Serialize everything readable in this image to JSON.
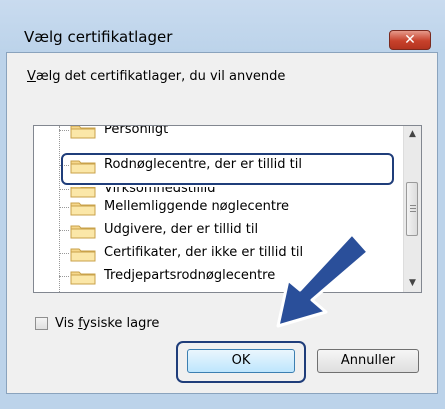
{
  "dialog": {
    "title": "Vælg certifikatlager",
    "close_label": "✕",
    "instruction_prefix": "V",
    "instruction_rest": "ælg det certifikatlager, du vil anvende"
  },
  "tree": {
    "items": [
      {
        "label": "Personligt"
      },
      {
        "label": "Rodnøglecentre, der er tillid til"
      },
      {
        "label": "Virksomhedstillid"
      },
      {
        "label": "Mellemliggende nøglecentre"
      },
      {
        "label": "Udgivere, der er tillid til"
      },
      {
        "label": "Certifikater, der ikke er tillid til"
      },
      {
        "label": "Tredjepartsrodnøglecentre"
      }
    ],
    "selected_index": 1
  },
  "options": {
    "show_physical_prefix": "Vis ",
    "show_physical_underlined": "f",
    "show_physical_rest": "ysiske lagre",
    "checked": false
  },
  "buttons": {
    "ok": "OK",
    "cancel": "Annuller"
  },
  "colors": {
    "frame": "#bcd3ea",
    "close_red": "#c7412b",
    "highlight": "#1f3d7a",
    "arrow": "#2a4f9a"
  }
}
